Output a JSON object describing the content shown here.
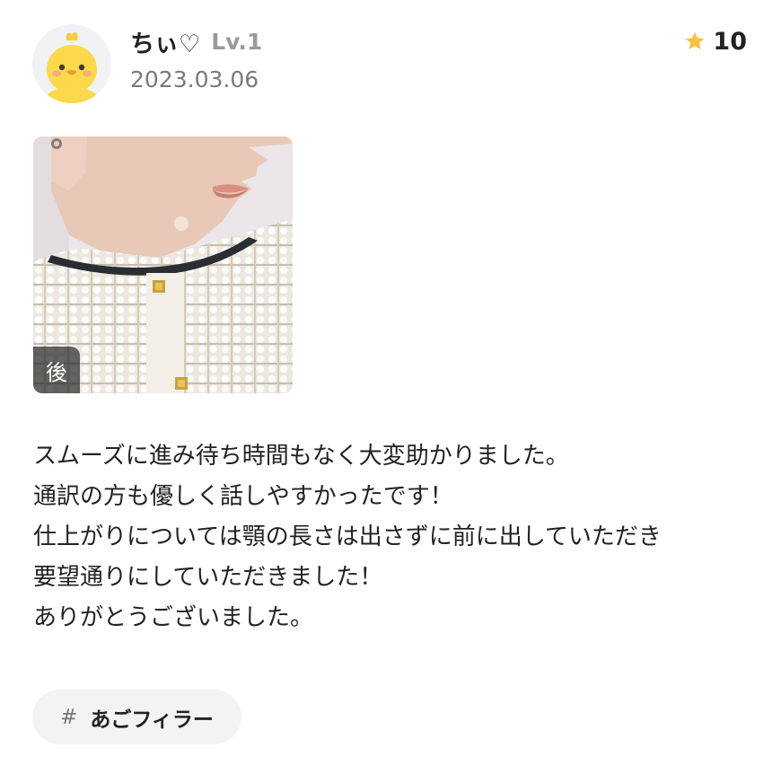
{
  "user": {
    "name": "ちぃ♡",
    "level": "Lv.1",
    "date": "2023.03.06",
    "avatar_icon": "chick-avatar-icon"
  },
  "score": {
    "icon": "star-icon",
    "value": "10",
    "star_color": "#f8c23b"
  },
  "photo": {
    "badge": "後"
  },
  "review": {
    "lines": [
      "スムーズに進み待ち時間もなく大変助かりました。",
      "通訳の方も優しく話しやすかったです！",
      "仕上がりについては顎の長さは出さずに前に出していただき",
      "要望通りにしていただきました！",
      "ありがとうございました。"
    ]
  },
  "tags": [
    {
      "hash": "#",
      "label": "あごフィラー"
    }
  ]
}
